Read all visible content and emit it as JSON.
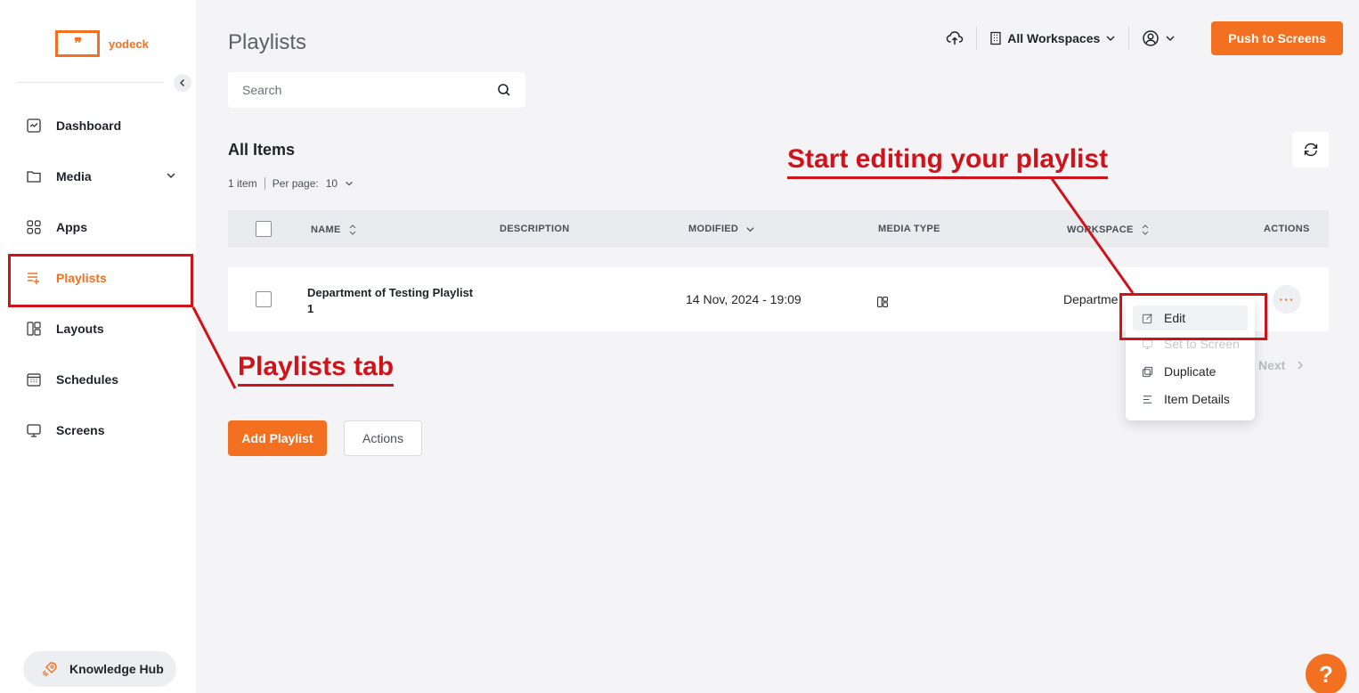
{
  "brand": {
    "logo_mark": "❞",
    "name": "yodeck",
    "accent": "#f37021"
  },
  "sidebar": {
    "items": [
      {
        "label": "Dashboard",
        "icon": "dashboard-icon"
      },
      {
        "label": "Media",
        "icon": "folder-icon"
      },
      {
        "label": "Apps",
        "icon": "apps-grid-icon"
      },
      {
        "label": "Playlists",
        "icon": "playlist-add-icon"
      },
      {
        "label": "Layouts",
        "icon": "layout-icon"
      },
      {
        "label": "Schedules",
        "icon": "calendar-icon"
      },
      {
        "label": "Screens",
        "icon": "monitor-icon"
      }
    ],
    "active": "Playlists",
    "knowledge_hub": "Knowledge Hub"
  },
  "header": {
    "title": "Playlists",
    "workspace": "All Workspaces",
    "push_button": "Push to Screens"
  },
  "search": {
    "placeholder": "Search"
  },
  "list": {
    "title": "All Items",
    "count": "1 item",
    "per_page_label": "Per page:",
    "per_page_value": "10",
    "columns": [
      "NAME",
      "DESCRIPTION",
      "MODIFIED",
      "MEDIA TYPE",
      "WORKSPACE",
      "ACTIONS"
    ],
    "rows": [
      {
        "name_line1": "Department of Testing Playlist",
        "name_line2": "1",
        "description": "",
        "modified": "14 Nov, 2024 - 19:09",
        "workspace": "Departme"
      }
    ],
    "next_label": "Next"
  },
  "buttons": {
    "add_playlist": "Add Playlist",
    "actions": "Actions"
  },
  "context_menu": {
    "items": [
      "Edit",
      "Set to Screen",
      "Duplicate",
      "Item Details"
    ]
  },
  "annotations": {
    "playlists_tab": "Playlists tab",
    "start_editing": "Start editing your playlist"
  },
  "help": {
    "label": "?"
  }
}
